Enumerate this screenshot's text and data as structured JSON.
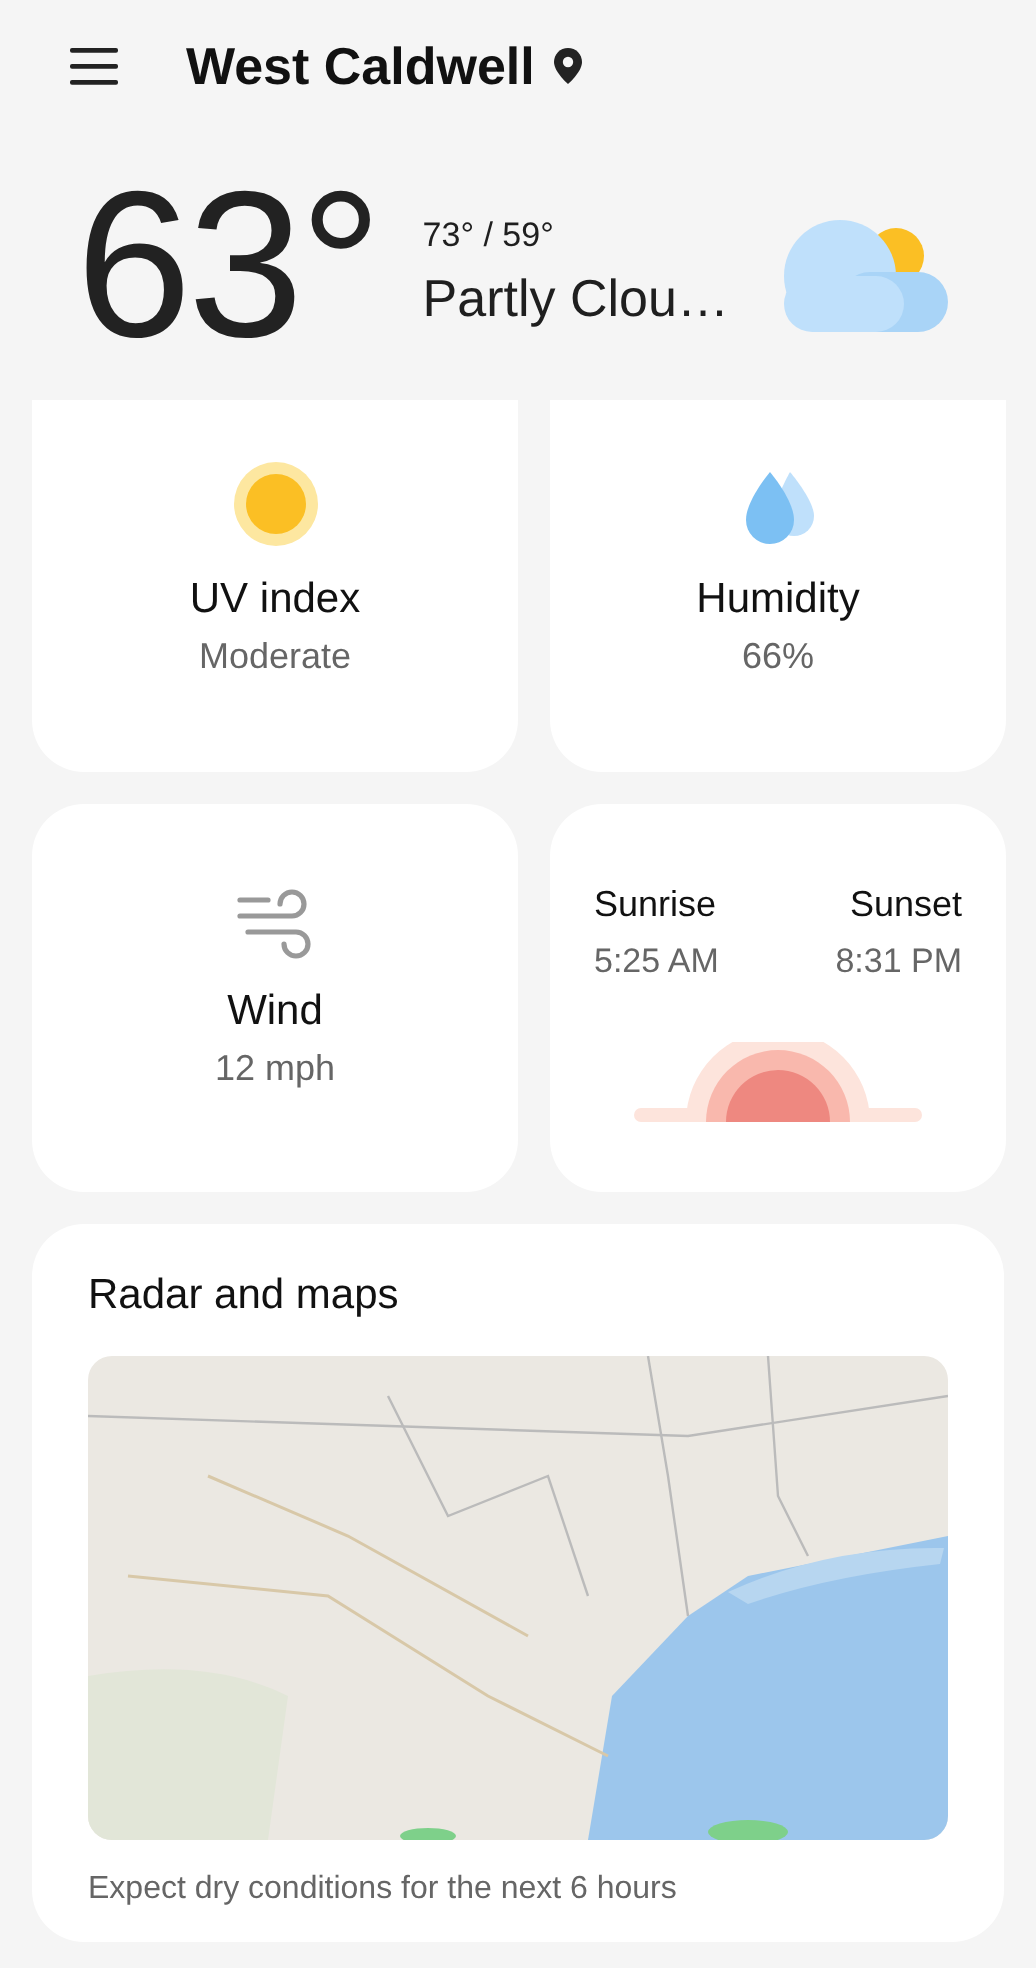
{
  "header": {
    "title": "West Caldwell"
  },
  "current": {
    "temperature": "63°",
    "high_low": "73° / 59°",
    "condition": "Partly Clou…"
  },
  "card_rows": [
    {
      "cards": [
        {
          "kind": "uv",
          "title": "UV index",
          "value": "Moderate"
        },
        {
          "kind": "humidity",
          "title": "Humidity",
          "value": "66%"
        }
      ]
    },
    {
      "cards": [
        {
          "kind": "wind",
          "title": "Wind",
          "value": "12 mph"
        },
        {
          "kind": "sun",
          "sunrise_label": "Sunrise",
          "sunrise_time": "5:25 AM",
          "sunset_label": "Sunset",
          "sunset_time": "8:31 PM"
        }
      ]
    }
  ],
  "radar": {
    "title": "Radar and maps",
    "caption": "Expect dry conditions for the next 6 hours"
  }
}
